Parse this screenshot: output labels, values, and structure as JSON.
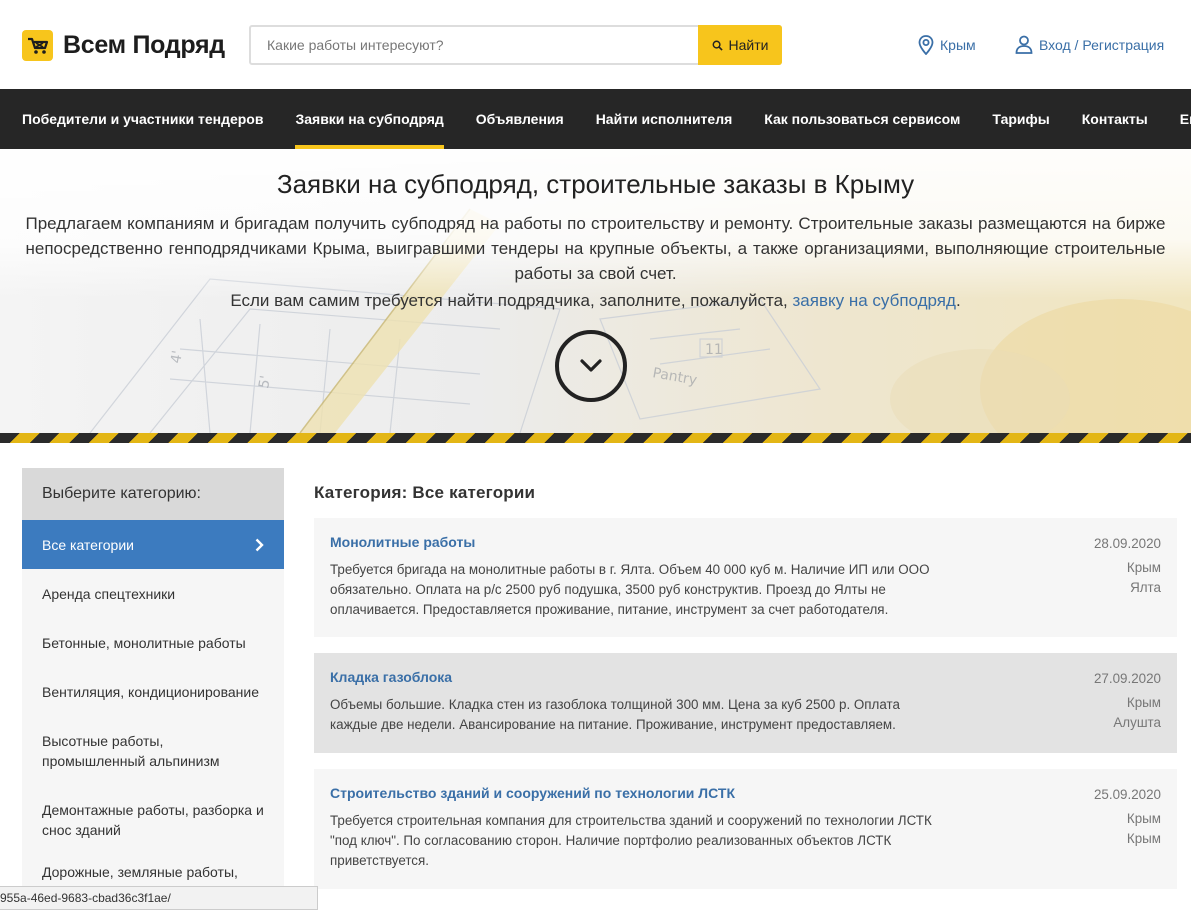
{
  "header": {
    "logo_text": "Всем Подряд",
    "search_placeholder": "Какие работы интересуют?",
    "search_button": "Найти",
    "region": "Крым",
    "login": "Вход / Регистрация"
  },
  "nav": [
    {
      "label": "Победители и участники тендеров"
    },
    {
      "label": "Заявки на субподряд"
    },
    {
      "label": "Объявления"
    },
    {
      "label": "Найти исполнителя"
    },
    {
      "label": "Как пользоваться сервисом"
    },
    {
      "label": "Тарифы"
    },
    {
      "label": "Контакты"
    },
    {
      "label": "Ещё"
    }
  ],
  "hero": {
    "title": "Заявки на субподряд, строительные заказы в Крыму",
    "description": "Предлагаем компаниям и бригадам получить субподряд на работы по строительству и ремонту. Строительные заказы размещаются на бирже непосредственно генподрядчиками Крыма, выигравшими тендеры на крупные объекты, а также организациями, выполняющие строительные работы за свой счет.",
    "note_prefix": "Если вам самим требуется найти подрядчика, заполните, пожалуйста, ",
    "note_link": "заявку на субподряд",
    "note_suffix": "."
  },
  "sidebar": {
    "heading": "Выберите категорию:",
    "items": [
      {
        "label": "Все категории"
      },
      {
        "label": "Аренда спецтехники"
      },
      {
        "label": "Бетонные, монолитные работы"
      },
      {
        "label": "Вентиляция, кондиционирование"
      },
      {
        "label": "Высотные работы, промышленный альпинизм"
      },
      {
        "label": "Демонтажные работы, разборка и снос зданий"
      },
      {
        "label": "Дорожные, земляные работы,"
      }
    ]
  },
  "main": {
    "category_title": "Категория: Все категории",
    "orders": [
      {
        "title": "Монолитные работы",
        "text": "Требуется бригада на монолитные работы в г. Ялта. Объем 40 000 куб м. Наличие ИП или ООО обязательно. Оплата на р/с 2500 руб подушка, 3500 руб конструктив. Проезд до Ялты не оплачивается. Предоставляется проживание, питание, инструмент за счет работодателя.",
        "date": "28.09.2020",
        "region": "Крым",
        "city": "Ялта"
      },
      {
        "title": "Кладка газоблока",
        "text": "Объемы большие. Кладка стен из газоблока толщиной 300 мм. Цена за куб 2500 р. Оплата каждые две недели. Авансирование на питание. Проживание, инструмент предоставляем.",
        "date": "27.09.2020",
        "region": "Крым",
        "city": "Алушта"
      },
      {
        "title": "Строительство зданий и сооружений по технологии ЛСТК",
        "text": "Требуется строительная компания для строительства зданий и сооружений по технологии ЛСТК \"под ключ\". По согласованию сторон. Наличие портфолио реализованных объектов ЛСТК приветствуется.",
        "date": "25.09.2020",
        "region": "Крым",
        "city": "Крым"
      }
    ]
  },
  "status_url": "955a-46ed-9683-cbad36c3f1ae/",
  "colors": {
    "accent_yellow": "#f7c51c",
    "nav_bg": "#262626",
    "link_blue": "#3a6fa7",
    "active_blue": "#3c7bbf"
  }
}
